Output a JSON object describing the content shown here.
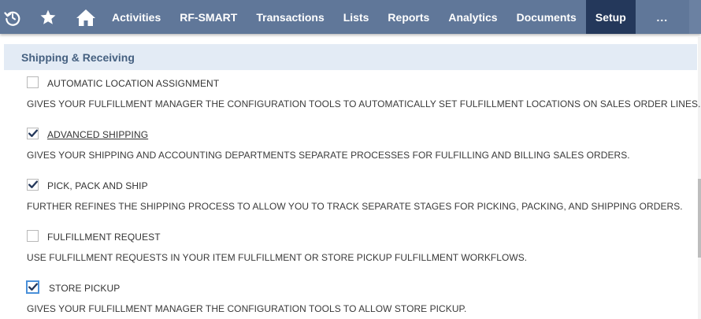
{
  "nav": {
    "items": [
      {
        "id": "activities",
        "label": "Activities"
      },
      {
        "id": "rf-smart",
        "label": "RF-SMART"
      },
      {
        "id": "transactions",
        "label": "Transactions"
      },
      {
        "id": "lists",
        "label": "Lists"
      },
      {
        "id": "reports",
        "label": "Reports"
      },
      {
        "id": "analytics",
        "label": "Analytics"
      },
      {
        "id": "documents",
        "label": "Documents"
      },
      {
        "id": "setup",
        "label": "Setup"
      }
    ],
    "active": "Setup",
    "more_label": "...",
    "icons": [
      "recent-icon",
      "star-icon",
      "home-icon"
    ],
    "colors": {
      "bar": "#607799",
      "active": "#24385b"
    }
  },
  "section": {
    "title": "Shipping & Receiving"
  },
  "features": [
    {
      "label": "AUTOMATIC LOCATION ASSIGNMENT",
      "description": "GIVES YOUR FULFILLMENT MANAGER THE CONFIGURATION TOOLS TO AUTOMATICALLY SET FULFILLMENT LOCATIONS ON SALES ORDER LINES.",
      "checked": false
    },
    {
      "label": "ADVANCED SHIPPING",
      "description": "GIVES YOUR SHIPPING AND ACCOUNTING DEPARTMENTS SEPARATE PROCESSES FOR FULFILLING AND BILLING SALES ORDERS.",
      "checked": true
    },
    {
      "label": "PICK, PACK AND SHIP",
      "description": "FURTHER REFINES THE SHIPPING PROCESS TO ALLOW YOU TO TRACK SEPARATE STAGES FOR PICKING, PACKING, AND SHIPPING ORDERS.",
      "checked": true
    },
    {
      "label": "FULFILLMENT REQUEST",
      "description": "USE FULFILLMENT REQUESTS IN YOUR ITEM FULFILLMENT OR STORE PICKUP FULFILLMENT WORKFLOWS.",
      "checked": false
    },
    {
      "label": "STORE PICKUP",
      "description": "GIVES YOUR FULFILLMENT MANAGER THE CONFIGURATION TOOLS TO ALLOW STORE PICKUP.",
      "checked": true
    }
  ]
}
